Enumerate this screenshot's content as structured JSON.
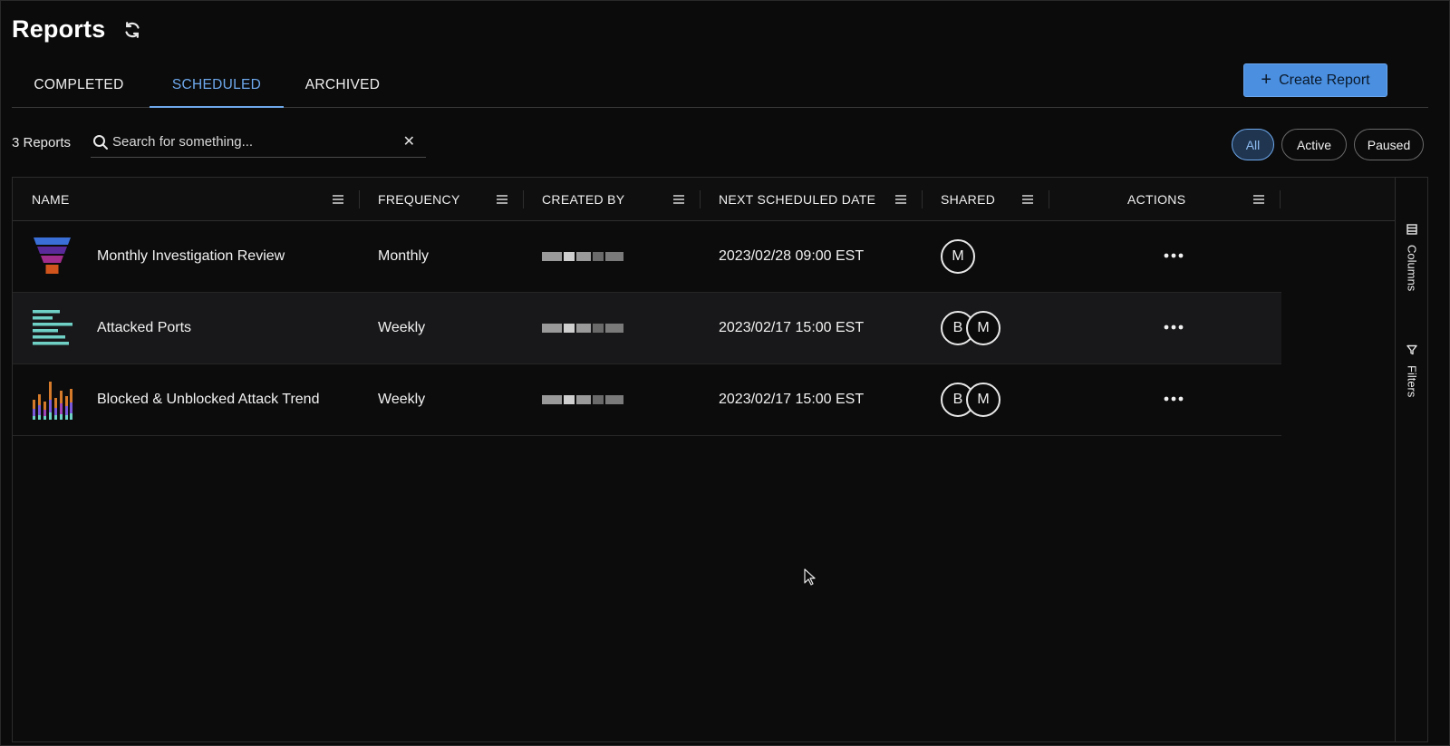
{
  "page": {
    "title": "Reports"
  },
  "tabs": [
    {
      "label": "COMPLETED",
      "active": false
    },
    {
      "label": "SCHEDULED",
      "active": true
    },
    {
      "label": "ARCHIVED",
      "active": false
    }
  ],
  "create_button": {
    "label": "Create Report",
    "icon": "plus-icon"
  },
  "toolbar": {
    "count_label": "3 Reports",
    "search_placeholder": "Search for something...",
    "search_value": ""
  },
  "filters": [
    {
      "label": "All",
      "active": true
    },
    {
      "label": "Active",
      "active": false
    },
    {
      "label": "Paused",
      "active": false
    }
  ],
  "columns": [
    "NAME",
    "FREQUENCY",
    "CREATED BY",
    "NEXT SCHEDULED DATE",
    "SHARED",
    "ACTIONS"
  ],
  "rows": [
    {
      "name": "Monthly Investigation Review",
      "frequency": "Monthly",
      "created_by_redacted": true,
      "next_date": "2023/02/28 09:00 EST",
      "shared": [
        "M"
      ],
      "thumbnail": "funnel-chart-icon"
    },
    {
      "name": "Attacked Ports",
      "frequency": "Weekly",
      "created_by_redacted": true,
      "next_date": "2023/02/17 15:00 EST",
      "shared": [
        "B",
        "M"
      ],
      "thumbnail": "horizontal-bar-chart-icon"
    },
    {
      "name": "Blocked & Unblocked Attack Trend",
      "frequency": "Weekly",
      "created_by_redacted": true,
      "next_date": "2023/02/17 15:00 EST",
      "shared": [
        "B",
        "M"
      ],
      "thumbnail": "stacked-bar-chart-icon"
    }
  ],
  "side_panel": {
    "columns_label": "Columns",
    "filters_label": "Filters"
  },
  "colors": {
    "accent": "#4a8fe0",
    "tab_active": "#6ea8ec",
    "background": "#0b0b0b"
  }
}
